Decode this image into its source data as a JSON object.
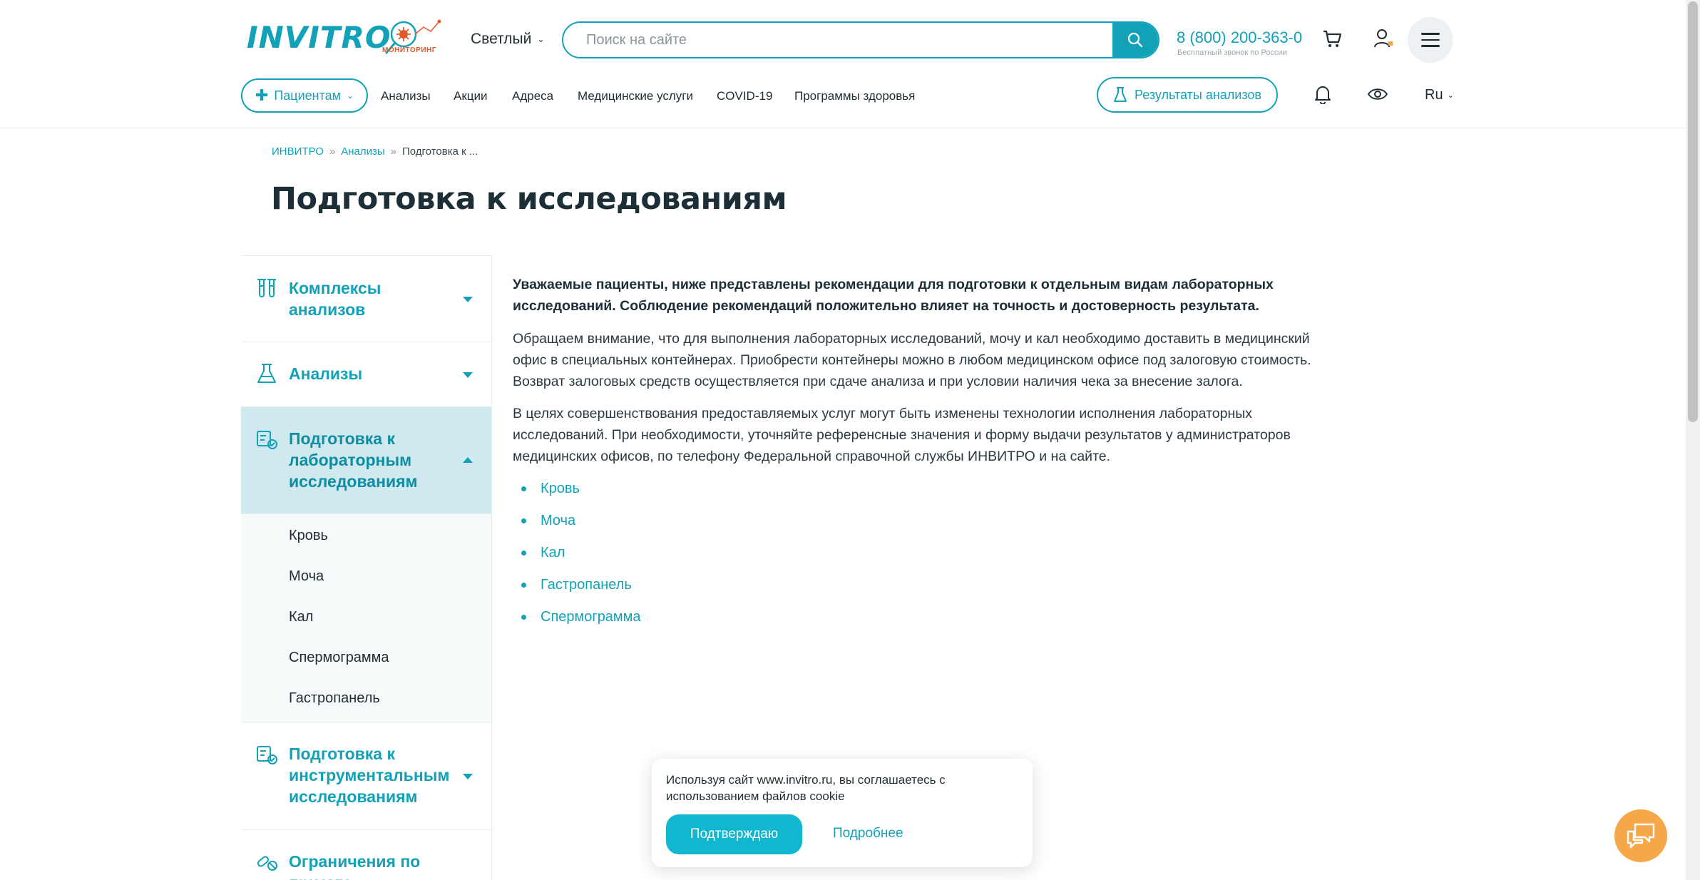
{
  "header": {
    "logo": "INVITRO",
    "monitoring_label": "МОНИТОРИНГ",
    "theme": "Светлый",
    "search_placeholder": "Поиск на сайте",
    "phone": "8 (800) 200-363-0",
    "phone_note": "Бесплатный звонок по России",
    "icons": [
      "search-icon",
      "cart-icon",
      "user-icon",
      "menu-icon",
      "bell-icon",
      "eye-icon",
      "flask-icon",
      "cross-icon"
    ]
  },
  "nav": {
    "patients": "Пациентам",
    "links": [
      "Анализы",
      "Акции",
      "Адреса",
      "Медицинские услуги",
      "COVID-19",
      "Программы здоровья"
    ],
    "results_button": "Результаты анализов",
    "language": "Ru"
  },
  "breadcrumb": {
    "items": [
      "ИНВИТРО",
      "Анализы",
      "Подготовка к ..."
    ],
    "separator": "»"
  },
  "page_title": "Подготовка к исследованиям",
  "sidebar": {
    "items": [
      {
        "label": "Комплексы анализов",
        "icon": "test-tubes-icon",
        "expanded": false
      },
      {
        "label": "Анализы",
        "icon": "flask-icon",
        "expanded": false
      },
      {
        "label": "Подготовка к лабораторным исследованиям",
        "icon": "checklist-icon",
        "expanded": true,
        "subitems": [
          "Кровь",
          "Моча",
          "Кал",
          "Спермограмма",
          "Гастропанель"
        ]
      },
      {
        "label": "Подготовка к инструментальным исследованиям",
        "icon": "checklist-icon",
        "expanded": false
      },
      {
        "label": "Ограничения по приему",
        "icon": "pills-icon",
        "expanded": false
      }
    ]
  },
  "content": {
    "intro": "Уважаемые пациенты, ниже представлены рекомендации для подготовки к отдельным видам лабораторных исследований. Соблюдение рекомендаций положительно влияет на точность и достоверность результата.",
    "paragraph1": "Обращаем внимание, что для выполнения лабораторных исследований, мочу и кал необходимо доставить в медицинский офис в специальных контейнерах. Приобрести контейнеры можно в любом медицинском офисе под залоговую стоимость. Возврат залоговых средств осуществляется при сдаче анализа и при условии наличия чека за внесение залога.",
    "paragraph2": "В целях совершенствования предоставляемых услуг могут быть изменены технологии исполнения лабораторных исследований. При необходимости, уточняйте референсные значения и форму выдачи результатов у администраторов медицинских офисов, по телефону Федеральной справочной службы ИНВИТРО и на сайте.",
    "links": [
      "Кровь",
      "Моча",
      "Кал",
      "Гастропанель",
      "Спермограмма"
    ]
  },
  "cookie": {
    "text": "Используя сайт www.invitro.ru, вы соглашаетесь с использованием файлов cookie",
    "accept": "Подтверждаю",
    "more": "Подробнее"
  },
  "colors": {
    "accent": "#11a2b8",
    "title": "#1c2e36",
    "active_bg": "#cfe9ef",
    "chat": "#f5a74a"
  }
}
